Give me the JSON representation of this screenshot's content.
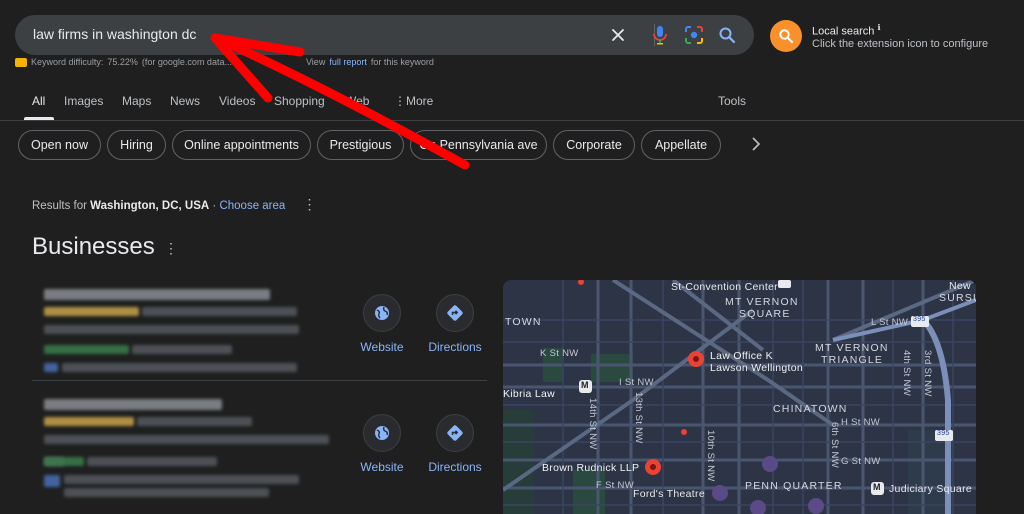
{
  "search": {
    "query": "law firms in washington dc"
  },
  "keyword_bar": {
    "difficulty_label": "Keyword difficulty:",
    "difficulty_value": "75.22%",
    "source": "(for google.com data...",
    "view_text": "View",
    "report_link": "full report",
    "suffix": "for this keyword"
  },
  "extension": {
    "title": "Local search",
    "info": "ℹ",
    "subtitle": "Click the extension icon to configure"
  },
  "tabs": {
    "items": [
      "All",
      "Images",
      "Maps",
      "News",
      "Videos",
      "Shopping",
      "Web",
      "More"
    ],
    "tools": "Tools",
    "more_dots": "⋮"
  },
  "chips": [
    "Open now",
    "Hiring",
    "Online appointments",
    "Prestigious",
    "On Pennsylvania ave",
    "Corporate",
    "Appellate"
  ],
  "results_for": {
    "prefix": "Results for",
    "location": "Washington, DC, USA",
    "separator": " · ",
    "link": "Choose area"
  },
  "businesses": {
    "heading": "Businesses",
    "actions": {
      "website": "Website",
      "directions": "Directions"
    }
  },
  "map": {
    "labels": {
      "convention": "St-Convention Center",
      "mt_vernon_sq_1": "MT VERNON",
      "mt_vernon_sq_2": "SQUARE",
      "mt_vernon_tri_1": "MT VERNON",
      "mt_vernon_tri_2": "TRIANGLE",
      "town": "TOWN",
      "chinatown": "CHINATOWN",
      "penn_quarter": "PENN QUARTER",
      "new": "New",
      "sursu": "SURSU",
      "k_st": "K St NW",
      "l_st": "L St NW",
      "i_st": "I St NW",
      "h_st": "H St NW",
      "g_st": "G St NW",
      "f_st": "F St NW",
      "st14": "14th St NW",
      "st13": "13th St NW",
      "st10": "10th St NW",
      "st6": "6th St NW",
      "st4": "4th St NW",
      "st3": "3rd St NW",
      "law_office_1": "Law Office K",
      "law_office_2": "Lawson Wellington",
      "kibria": "Kibria Law",
      "brown": "Brown Rudnick LLP",
      "fords": "Ford's Theatre",
      "judiciary": "Judiciary Square",
      "route": "395",
      "metro": "M"
    }
  },
  "colors": {
    "background": "#1f1f1f",
    "search_bg": "#3c4043",
    "link": "#8ab4f8",
    "extension": "#f8912c",
    "pin": "#ea4335",
    "arrow": "#ff0000",
    "map_bg": "#2c3446"
  }
}
